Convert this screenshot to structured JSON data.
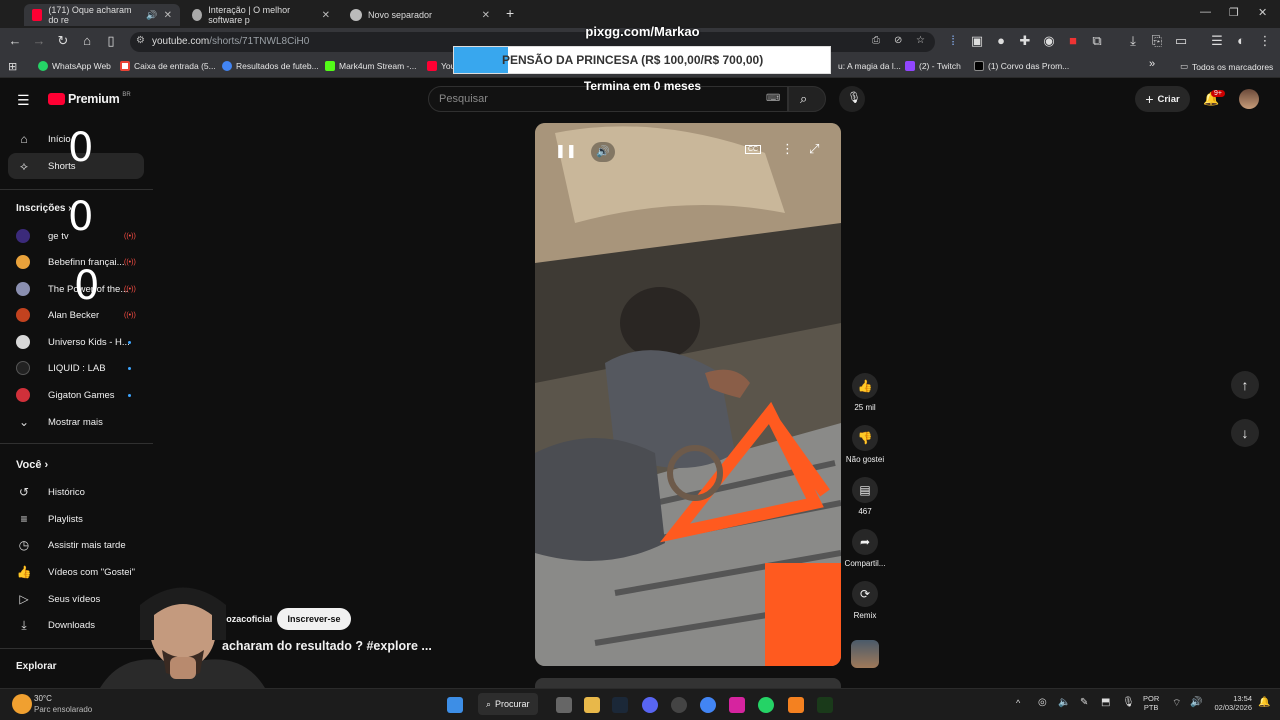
{
  "browser": {
    "tabs": [
      {
        "label": "(171) Oque acharam do re",
        "active": true
      },
      {
        "label": "Interação | O melhor software p",
        "active": false
      },
      {
        "label": "Novo separador",
        "active": false
      }
    ],
    "url_host": "youtube.com",
    "url_path": "/shorts/71TNWL8CiH0",
    "bookmarks": [
      "WhatsApp Web",
      "Caixa de entrada (5...",
      "Resultados de futeb...",
      "Mark4um Stream -...",
      "You",
      "u: A magia da l...",
      "(2) - Twitch",
      "(1) Corvo das Prom..."
    ],
    "bookmarks_more": "»",
    "all_bookmarks": "Todos os marcadores"
  },
  "overlay": {
    "title": "pixgg.com/Markao",
    "goal_text": "PENSÃO DA PRINCESA (R$ 100,00/R$ 700,00)",
    "goal_progress": 0.143,
    "subtitle": "Termina em 0 meses",
    "counters": [
      "0",
      "0",
      "0"
    ]
  },
  "youtube": {
    "logo": "Premium",
    "logo_region": "BR",
    "search_placeholder": "Pesquisar",
    "create_label": "Criar",
    "notif_badge": "9+",
    "sidebar": {
      "home": "Início",
      "shorts": "Shorts",
      "subs_title": "Inscrições",
      "subscriptions": [
        {
          "name": "ge tv",
          "status": "live",
          "color": "#3b2a7a"
        },
        {
          "name": "Bebefinn françai...",
          "status": "live",
          "color": "#e9a23b"
        },
        {
          "name": "The Power of the...",
          "status": "live",
          "color": "#8a8fb0"
        },
        {
          "name": "Alan Becker",
          "status": "live",
          "color": "#c2421f"
        },
        {
          "name": "Universo Kids - H...",
          "status": "new",
          "color": "#d8d8d8"
        },
        {
          "name": "LIQUID : LAB",
          "status": "new",
          "color": "#222222"
        },
        {
          "name": "Gigaton Games",
          "status": "new",
          "color": "#d0303a"
        }
      ],
      "more": "Mostrar mais",
      "you_title": "Você",
      "you_items": [
        "Histórico",
        "Playlists",
        "Assistir mais tarde",
        "Vídeos com \"Gostei\"",
        "Seus vídeos",
        "Downloads"
      ],
      "explore_title": "Explorar"
    },
    "short": {
      "channel": "@Mozacoficial",
      "subscribe": "Inscrever-se",
      "title": "acharam do resultado ? #explore ...",
      "likes": "25 mil",
      "dislike_label": "Não gostei",
      "comments": "467",
      "share": "Compartil...",
      "remix": "Remix",
      "cc_label": "CC"
    }
  },
  "taskbar": {
    "weather_temp": "30°C",
    "weather_desc": "Parc ensolarado",
    "search_label": "Procurar",
    "lang_top": "POR",
    "lang_bottom": "PTB",
    "time": "13:54",
    "date": "02/03/2026"
  },
  "colors": {
    "youtube_red": "#ff0033",
    "accent_blue": "#3ea6ff",
    "overlay_fill": "#38a7ee"
  }
}
